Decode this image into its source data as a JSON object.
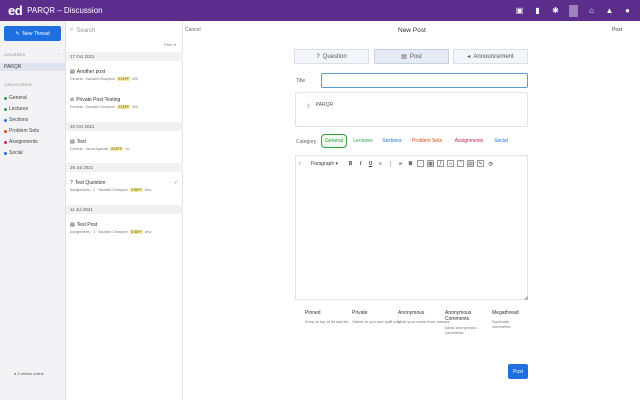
{
  "app": {
    "logo": "ed",
    "title": "PARQR – Discussion"
  },
  "topbar_icons": [
    "chat-icon",
    "chart-icon",
    "gear-icon",
    "home-icon",
    "bell-icon",
    "user-icon"
  ],
  "sidebar": {
    "new_thread": "New Thread",
    "courses_label": "COURSES",
    "course": "PARQR",
    "categories_label": "CATEGORIES",
    "categories": [
      {
        "label": "General",
        "color": "#2f9e44"
      },
      {
        "label": "Lectures",
        "color": "#2f9e44"
      },
      {
        "label": "Sections",
        "color": "#1f6fe0"
      },
      {
        "label": "Problem Sets",
        "color": "#d9480f"
      },
      {
        "label": "Assignments",
        "color": "#c2255c"
      },
      {
        "label": "Social",
        "color": "#1f6fe0"
      }
    ],
    "online": "0 others online"
  },
  "threads": {
    "search_placeholder": "Search",
    "filter": "Filter",
    "groups": [
      {
        "date": "17 Oct 2021",
        "items": [
          {
            "title": "Another post",
            "meta": "General · Saurabh Chanpure",
            "badge": "STAFF",
            "time": "20h"
          },
          {
            "title": "Private Post Testing",
            "meta": "General · Saurabh Chanpure",
            "badge": "STAFF",
            "time": "20h"
          }
        ]
      },
      {
        "date": "10 Oct 2021",
        "items": [
          {
            "title": "Test",
            "meta": "General · Varun Agarwal",
            "badge": "STAFF",
            "time": "1w"
          }
        ]
      },
      {
        "date": "26 Jul 2021",
        "items": [
          {
            "title": "Test Question",
            "meta": "Assignments · 2 · Saurabh Chanpure",
            "badge": "STAFF",
            "time": "2mo"
          }
        ]
      },
      {
        "date": "11 Jul 2021",
        "items": [
          {
            "title": "Test Post",
            "meta": "Assignments · 1 · Saurabh Chanpure",
            "badge": "STAFF",
            "time": "3mo"
          }
        ]
      }
    ]
  },
  "main": {
    "cancel": "Cancel",
    "title": "New Post",
    "post": "Post",
    "types": [
      "Question",
      "Post",
      "Announcement"
    ],
    "title_label": "Title",
    "parqr": "PARQR",
    "category_label": "Category",
    "categories": [
      "General",
      "Lectures",
      "Sections",
      "Problem Sets",
      "Assignments",
      "Social"
    ],
    "paragraph": "Paragraph",
    "options": [
      {
        "title": "Pinned",
        "desc": "Keep at top of thread list"
      },
      {
        "title": "Private",
        "desc": "Visible to you and staff only"
      },
      {
        "title": "Anonymous",
        "desc": "Hide your name from classes"
      },
      {
        "title": "Anonymous Comments",
        "desc": "Allow anonymous comments"
      },
      {
        "title": "Megathread",
        "desc": "Nominate comments"
      }
    ],
    "submit": "Post"
  }
}
